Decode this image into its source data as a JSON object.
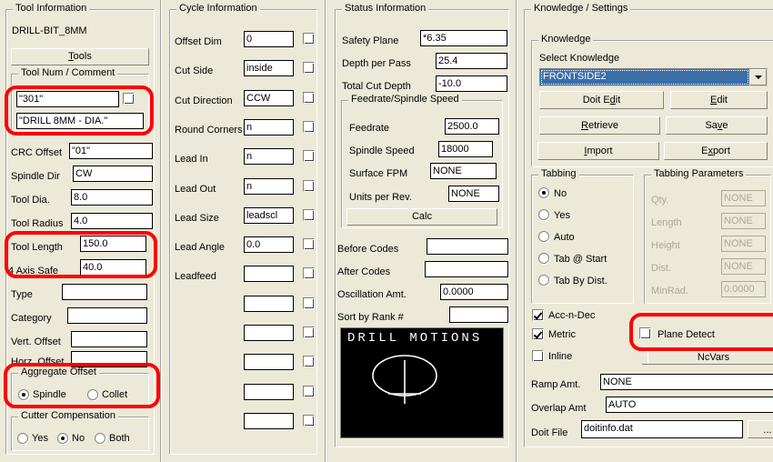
{
  "tool_information": {
    "title": "Tool Information",
    "tool_name": "DRILL-BIT_8MM",
    "tools_button": "Tools",
    "tool_num_comment": {
      "title": "Tool Num / Comment",
      "tool_num_value": "\"301\"",
      "comment_value": "\"DRILL 8MM - DIA.\""
    },
    "fields": [
      {
        "label": "CRC Offset",
        "value": "\"01\""
      },
      {
        "label": "Spindle Dir",
        "value": "CW"
      },
      {
        "label": "Tool Dia.",
        "value": "8.0"
      },
      {
        "label": "Tool Radius",
        "value": "4.0"
      },
      {
        "label": "Tool Length",
        "value": "150.0"
      },
      {
        "label": "4 Axis Safe",
        "value": "40.0"
      },
      {
        "label": "Type",
        "value": ""
      },
      {
        "label": "Category",
        "value": ""
      },
      {
        "label": "Vert. Offset",
        "value": ""
      },
      {
        "label": "Horz. Offset",
        "value": ""
      }
    ],
    "aggregate_offset": {
      "title": "Aggregate Offset",
      "options": [
        "Spindle",
        "Collet"
      ],
      "selected": "Spindle"
    },
    "cutter_compensation": {
      "title": "Cutter Compensation",
      "options": [
        "Yes",
        "No",
        "Both"
      ],
      "selected": "No"
    }
  },
  "cycle_information": {
    "title": "Cycle Information",
    "rows": [
      {
        "label": "Offset Dim",
        "value": "0",
        "checked": false
      },
      {
        "label": "Cut Side",
        "value": "inside",
        "checked": false
      },
      {
        "label": "Cut Direction",
        "value": "CCW",
        "checked": false
      },
      {
        "label": "Round Corners",
        "value": "n",
        "checked": false
      },
      {
        "label": "Lead In",
        "value": "n",
        "checked": false
      },
      {
        "label": "Lead Out",
        "value": "n",
        "checked": false
      },
      {
        "label": "Lead Size",
        "value": "leadscl",
        "checked": false
      },
      {
        "label": "Lead Angle",
        "value": "0.0",
        "checked": false
      },
      {
        "label": "Leadfeed",
        "value": "",
        "checked": false
      },
      {
        "label": "",
        "value": "",
        "checked": false
      },
      {
        "label": "",
        "value": "",
        "checked": false
      },
      {
        "label": "",
        "value": "",
        "checked": false
      },
      {
        "label": "",
        "value": "",
        "checked": false
      },
      {
        "label": "",
        "value": "",
        "checked": false
      }
    ]
  },
  "status_information": {
    "title": "Status Information",
    "top_fields": [
      {
        "label": "Safety Plane",
        "value": "*6.35"
      },
      {
        "label": "Depth per Pass",
        "value": "25.4"
      },
      {
        "label": "Total Cut Depth",
        "value": "-10.0"
      }
    ],
    "feedrate_group": {
      "title": "Feedrate/Spindle Speed",
      "fields": [
        {
          "label": "Feedrate",
          "value": "2500.0"
        },
        {
          "label": "Spindle Speed",
          "value": "18000"
        },
        {
          "label": "Surface FPM",
          "value": "NONE"
        },
        {
          "label": "Units per Rev.",
          "value": "NONE"
        }
      ],
      "calc_button": "Calc"
    },
    "bottom_fields": [
      {
        "label": "Before Codes",
        "value": ""
      },
      {
        "label": "After Codes",
        "value": ""
      },
      {
        "label": "Oscillation Amt.",
        "value": "0.0000"
      },
      {
        "label": "Sort by Rank #",
        "value": ""
      }
    ],
    "preview_title": "DRILL MOTIONS"
  },
  "knowledge_settings": {
    "title": "Knowledge / Settings",
    "knowledge": {
      "title": "Knowledge",
      "select_label": "Select Knowledge",
      "selected_value": "FRONTSIDE2",
      "buttons": [
        {
          "label": "Doit Edit",
          "accel": "d"
        },
        {
          "label": "Edit",
          "accel": "E"
        },
        {
          "label": "Retrieve",
          "accel": "R"
        },
        {
          "label": "Save",
          "accel": "v"
        },
        {
          "label": "Import",
          "accel": "I"
        },
        {
          "label": "Export",
          "accel": "x"
        }
      ]
    },
    "tabbing": {
      "title": "Tabbing",
      "options": [
        "No",
        "Yes",
        "Auto",
        "Tab @ Start",
        "Tab By Dist."
      ],
      "selected": "No"
    },
    "tabbing_parameters": {
      "title": "Tabbing Parameters",
      "enabled": false,
      "rows": [
        {
          "label": "Qty.",
          "value": "NONE"
        },
        {
          "label": "Length",
          "value": "NONE"
        },
        {
          "label": "Height",
          "value": "NONE"
        },
        {
          "label": "Dist.",
          "value": "NONE"
        },
        {
          "label": "MinRad.",
          "value": "0.0000"
        }
      ]
    },
    "checkboxes": [
      {
        "label": "Acc-n-Dec",
        "checked": true
      },
      {
        "label": "Metric",
        "checked": true
      },
      {
        "label": "Inline",
        "checked": false
      },
      {
        "label": "Plane Detect",
        "checked": false
      }
    ],
    "ncvars_tab": "NcVars",
    "bottom_fields": [
      {
        "label": "Ramp Amt.",
        "value": "NONE"
      },
      {
        "label": "Overlap Amt",
        "value": "AUTO"
      },
      {
        "label": "Doit File",
        "value": "doitinfo.dat"
      }
    ],
    "browse_button": "..."
  },
  "annotations": {
    "color": "#fe0000",
    "boxes": [
      "tool-num-comment-highlight",
      "tool-length-axis-safe-highlight",
      "aggregate-offset-highlight",
      "plane-detect-highlight"
    ]
  }
}
